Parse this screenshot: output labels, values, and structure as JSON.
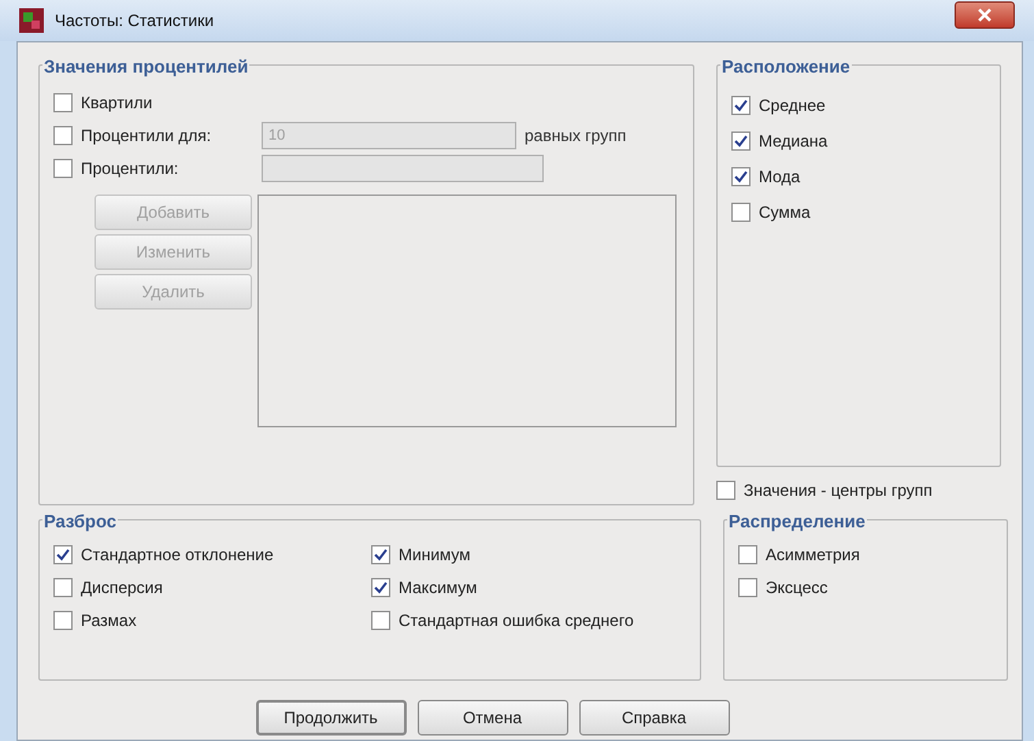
{
  "window": {
    "title": "Частоты: Статистики"
  },
  "percentiles": {
    "title": "Значения процентилей",
    "quartiles": {
      "label": "Квартили",
      "checked": false
    },
    "cut_points": {
      "label": "Процентили для:",
      "checked": false,
      "value": "10",
      "disabled": true,
      "suffix": "равных групп"
    },
    "percentiles": {
      "label": "Процентили:",
      "checked": false,
      "disabled": true
    },
    "buttons": [
      {
        "label": "Добавить",
        "disabled": true
      },
      {
        "label": "Изменить",
        "disabled": true
      },
      {
        "label": "Удалить",
        "disabled": true
      }
    ]
  },
  "location": {
    "title": "Расположение",
    "items": [
      {
        "label": "Среднее",
        "checked": true
      },
      {
        "label": "Медиана",
        "checked": true
      },
      {
        "label": "Мода",
        "checked": true
      },
      {
        "label": "Сумма",
        "checked": false
      }
    ]
  },
  "group_midpoints": {
    "label": "Значения - центры групп",
    "checked": false
  },
  "dispersion": {
    "title": "Разброс",
    "items": [
      {
        "label": "Стандартное отклонение",
        "checked": true
      },
      {
        "label": "Минимум",
        "checked": true
      },
      {
        "label": "Дисперсия",
        "checked": false
      },
      {
        "label": "Максимум",
        "checked": true
      },
      {
        "label": "Размах",
        "checked": false
      },
      {
        "label": "Стандартная ошибка среднего",
        "checked": false
      }
    ]
  },
  "distribution": {
    "title": "Распределение",
    "items": [
      {
        "label": "Асимметрия",
        "checked": false
      },
      {
        "label": "Эксцесс",
        "checked": false
      }
    ]
  },
  "buttons": [
    {
      "label": "Продолжить",
      "default": true
    },
    {
      "label": "Отмена",
      "default": false
    },
    {
      "label": "Справка",
      "default": false
    }
  ]
}
